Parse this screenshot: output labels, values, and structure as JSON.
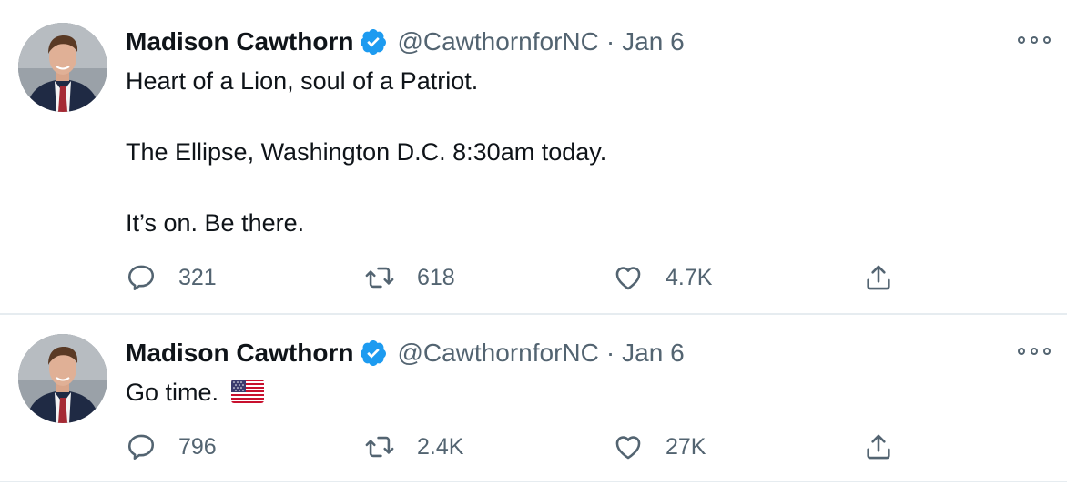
{
  "colors": {
    "verified": "#1d9bf0",
    "secondary_text": "#536471",
    "primary_text": "#0f1419",
    "divider": "#e6ecf0"
  },
  "tweets": [
    {
      "name": "Madison Cawthorn",
      "verified_icon": "verified-badge-icon",
      "handle": "@CawthornforNC",
      "separator": "·",
      "date": "Jan 6",
      "text_lines": [
        "Heart of a Lion, soul of a Patriot.",
        "The Ellipse, Washington D.C. 8:30am today.",
        "It’s on. Be there."
      ],
      "replies": "321",
      "retweets": "618",
      "likes": "4.7K"
    },
    {
      "name": "Madison Cawthorn",
      "verified_icon": "verified-badge-icon",
      "handle": "@CawthornforNC",
      "separator": "·",
      "date": "Jan 6",
      "text_lines": [
        "Go time."
      ],
      "emoji": "us-flag-emoji",
      "replies": "796",
      "retweets": "2.4K",
      "likes": "27K"
    }
  ]
}
